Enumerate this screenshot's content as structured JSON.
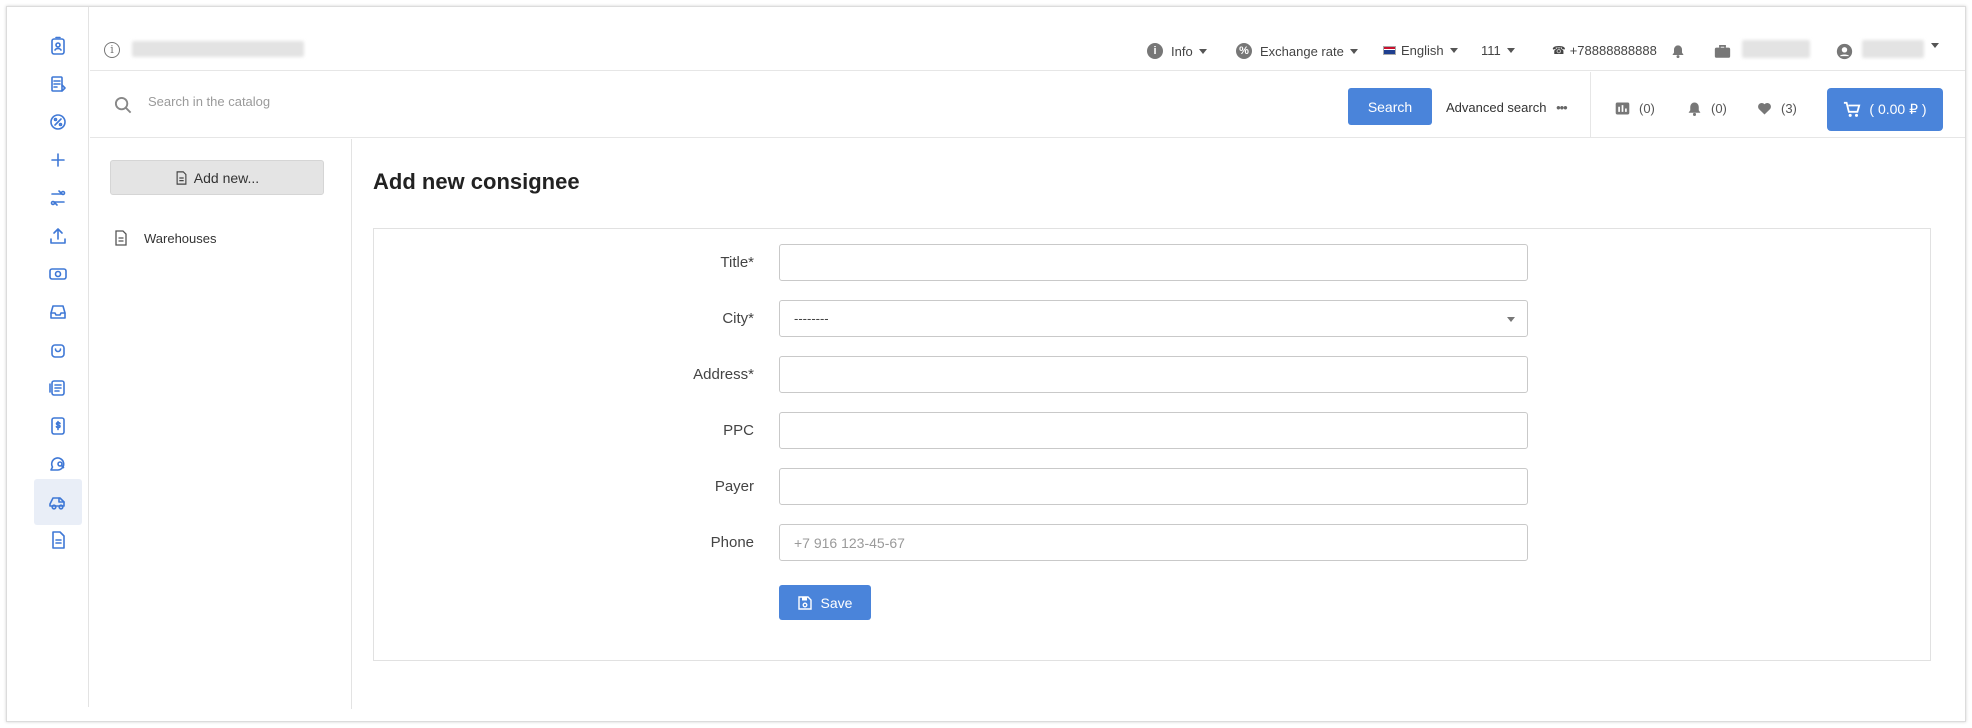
{
  "topbar": {
    "info_label": "Info",
    "exchange_label": "Exchange rate",
    "language_label": "English",
    "account_number": "111",
    "phone": "+78888888888"
  },
  "search": {
    "placeholder": "Search in the catalog",
    "button_label": "Search",
    "advanced_label": "Advanced search"
  },
  "counters": {
    "compare": "(0)",
    "notifications": "(0)",
    "favorites": "(3)"
  },
  "cart": {
    "label": "( 0.00 ₽ )"
  },
  "sidebar": {
    "add_new_label": "Add new...",
    "links": [
      {
        "label": "Warehouses"
      }
    ]
  },
  "rail": {
    "icons": [
      "id-badge-icon",
      "contract-icon",
      "percent-icon",
      "plus-icon",
      "exchange-icon",
      "upload-icon",
      "money-icon",
      "inbox-icon",
      "bag-icon",
      "document-list-icon",
      "invoice-dollar-icon",
      "chat-search-icon",
      "delivery-truck-icon",
      "file-icon"
    ],
    "active_index": 12
  },
  "page": {
    "title": "Add new consignee"
  },
  "form": {
    "title_label": "Title*",
    "city_label": "City*",
    "city_value": "--------",
    "address_label": "Address*",
    "ppc_label": "PPC",
    "payer_label": "Payer",
    "phone_label": "Phone",
    "phone_placeholder": "+7 916 123-45-67",
    "save_label": "Save"
  },
  "colors": {
    "accent": "#4a84da",
    "rail_icon": "#3f78d6"
  }
}
